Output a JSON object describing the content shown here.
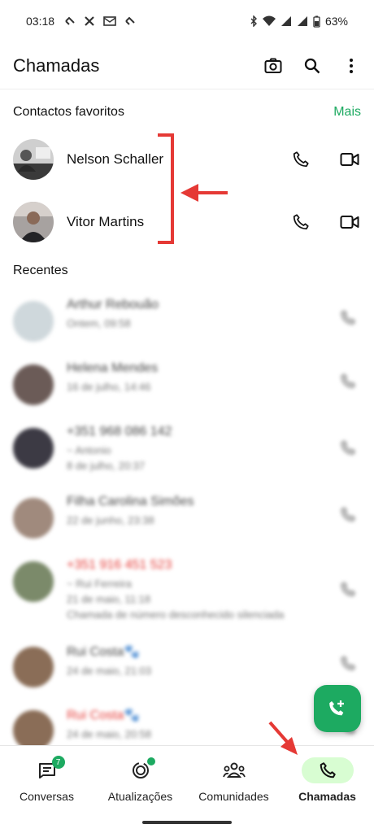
{
  "status_bar": {
    "time": "03:18",
    "battery": "63%"
  },
  "app_bar": {
    "title": "Chamadas",
    "icons": [
      "camera-icon",
      "search-icon",
      "more-vert-icon"
    ]
  },
  "favorites": {
    "heading": "Contactos favoritos",
    "more_label": "Mais",
    "items": [
      {
        "name": "Nelson Schaller"
      },
      {
        "name": "Vitor Martins"
      }
    ]
  },
  "recents": {
    "heading": "Recentes",
    "items": [
      {
        "name": "Arthur Rebouão",
        "lines": [
          "Ontem, 09:58"
        ],
        "missed": false,
        "avatar_color": "#cfd8dc"
      },
      {
        "name": "Helena Mendes",
        "lines": [
          "16 de julho, 14:46"
        ],
        "missed": false,
        "avatar_color": "#6b5b57"
      },
      {
        "name": "+351 968 086 142",
        "lines": [
          "~ Antonio",
          "8 de julho, 20:37"
        ],
        "missed": false,
        "avatar_color": "#3c3a44"
      },
      {
        "name": "Filha Carolina Simões",
        "lines": [
          "22 de junho, 23:38"
        ],
        "missed": false,
        "avatar_color": "#a08a7d"
      },
      {
        "name": "+351 916 451 523",
        "lines": [
          "~ Rui Ferreira",
          "21 de maio, 11:18",
          "Chamada de número desconhecido silenciada"
        ],
        "missed": true,
        "avatar_color": "#7b8a6a"
      },
      {
        "name": "Rui Costa🐾",
        "lines": [
          "24 de maio, 21:03"
        ],
        "missed": false,
        "avatar_color": "#8a6d57"
      },
      {
        "name": "Rui Costa🐾",
        "lines": [
          "24 de maio, 20:58"
        ],
        "missed": true,
        "avatar_color": "#8a6d57"
      }
    ]
  },
  "bottom_nav": {
    "items": [
      {
        "label": "Conversas",
        "badge": "7",
        "icon": "chat-icon"
      },
      {
        "label": "Atualizações",
        "icon": "status-icon"
      },
      {
        "label": "Comunidades",
        "icon": "communities-icon"
      },
      {
        "label": "Chamadas",
        "icon": "phone-icon",
        "active": true
      }
    ]
  },
  "colors": {
    "accent": "#1daa61",
    "annotation": "#e53935",
    "active_nav_bg": "#d8fdd2"
  }
}
